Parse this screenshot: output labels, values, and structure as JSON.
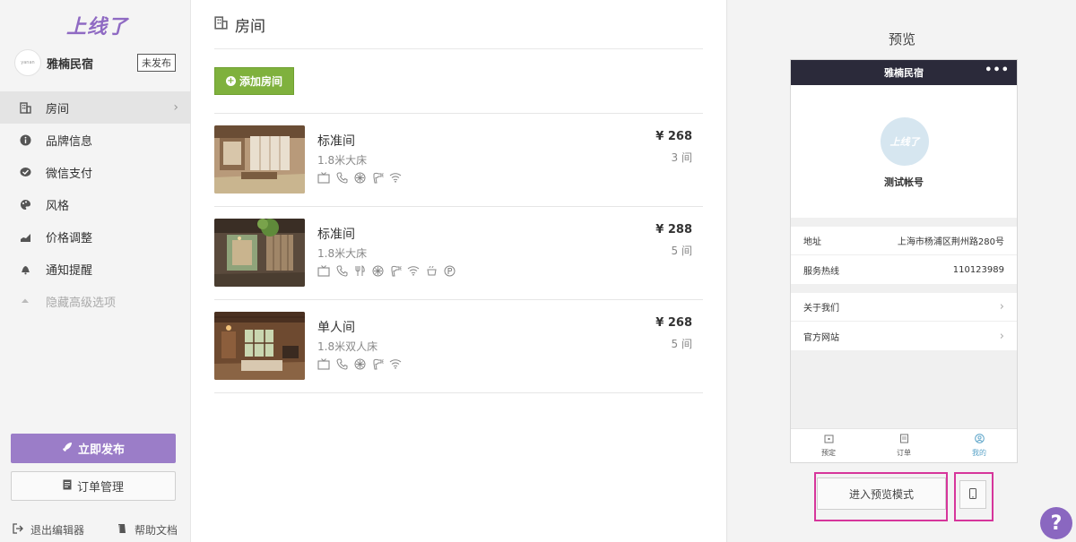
{
  "sidebar": {
    "logo": "上线了",
    "account": {
      "name": "雅楠民宿",
      "avatar_text": "yanan",
      "status_badge": "未发布"
    },
    "items": [
      {
        "label": "房间",
        "icon": "building-icon",
        "active": true
      },
      {
        "label": "品牌信息",
        "icon": "info-icon"
      },
      {
        "label": "微信支付",
        "icon": "wechat-pay-icon"
      },
      {
        "label": "风格",
        "icon": "palette-icon"
      },
      {
        "label": "价格调整",
        "icon": "bar-chart-icon"
      },
      {
        "label": "通知提醒",
        "icon": "bell-icon"
      },
      {
        "label": "隐藏高级选项",
        "icon": "triangle-up-icon",
        "muted": true
      }
    ],
    "publish_label": "立即发布",
    "orders_label": "订单管理",
    "footer": {
      "exit_label": "退出编辑器",
      "help_label": "帮助文档"
    }
  },
  "main": {
    "title": "房间",
    "add_room_label": "添加房间",
    "rooms": [
      {
        "name": "标准间",
        "bed": "1.8米大床",
        "price": "¥ 268",
        "count": "3 间",
        "amenities": [
          "tv-icon",
          "phone-icon",
          "ac-icon",
          "hairdryer-icon",
          "wifi-icon"
        ]
      },
      {
        "name": "标准间",
        "bed": "1.8米大床",
        "price": "¥ 288",
        "count": "5 间",
        "amenities": [
          "tv-icon",
          "phone-icon",
          "restaurant-icon",
          "ac-icon",
          "hairdryer-icon",
          "wifi-icon",
          "breakfast-icon",
          "parking-icon"
        ]
      },
      {
        "name": "单人间",
        "bed": "1.8米双人床",
        "price": "¥ 268",
        "count": "5 间",
        "amenities": [
          "tv-icon",
          "phone-icon",
          "ac-icon",
          "hairdryer-icon",
          "wifi-icon"
        ]
      }
    ]
  },
  "preview": {
    "title": "预览",
    "phone": {
      "header_title": "雅楠民宿",
      "menu_dots": "•••",
      "avatar_text": "上线了",
      "profile_name": "测试帐号",
      "address_label": "地址",
      "address_value": "上海市杨浦区荆州路280号",
      "hotline_label": "服务热线",
      "hotline_value": "110123989",
      "about_label": "关于我们",
      "website_label": "官方网站",
      "tabs": [
        {
          "label": "预定",
          "icon": "calendar-icon"
        },
        {
          "label": "订单",
          "icon": "order-icon"
        },
        {
          "label": "我的",
          "icon": "user-circle-icon",
          "active": true
        }
      ]
    },
    "preview_mode_label": "进入预览模式",
    "help_symbol": "?"
  },
  "colors": {
    "brand": "#8f6ac3",
    "publish": "#9b7dc8",
    "add_button": "#7fb13d",
    "phone_header": "#2b2a3a",
    "highlight": "#d6359b",
    "tab_active": "#5aa3c8"
  }
}
